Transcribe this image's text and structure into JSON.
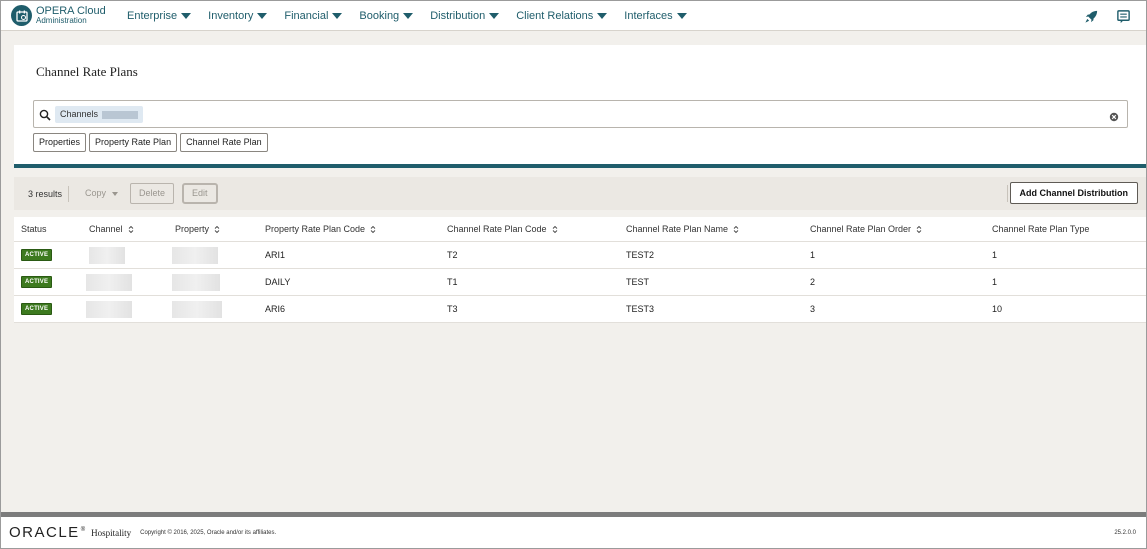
{
  "brand": {
    "title": "OPERA Cloud",
    "subtitle": "Administration"
  },
  "nav": {
    "items": [
      "Enterprise",
      "Inventory",
      "Financial",
      "Booking",
      "Distribution",
      "Client Relations",
      "Interfaces"
    ]
  },
  "page": {
    "title": "Channel Rate Plans"
  },
  "search": {
    "chip_label": "Channels"
  },
  "filters": [
    "Properties",
    "Property Rate Plan",
    "Channel Rate Plan"
  ],
  "toolbar": {
    "results": "3 results",
    "copy": "Copy",
    "delete": "Delete",
    "edit": "Edit",
    "add": "Add Channel Distribution"
  },
  "table": {
    "columns": [
      "Status",
      "Channel",
      "Property",
      "Property Rate Plan Code",
      "Channel Rate Plan Code",
      "Channel Rate Plan Name",
      "Channel Rate Plan Order",
      "Channel Rate Plan Type"
    ],
    "rows": [
      {
        "status": "ACTIVE",
        "property_rate_plan_code": "ARI1",
        "channel_rate_plan_code": "T2",
        "channel_rate_plan_name": "TEST2",
        "order": "1",
        "type": "1"
      },
      {
        "status": "ACTIVE",
        "property_rate_plan_code": "DAILY",
        "channel_rate_plan_code": "T1",
        "channel_rate_plan_name": "TEST",
        "order": "2",
        "type": "1"
      },
      {
        "status": "ACTIVE",
        "property_rate_plan_code": "ARI6",
        "channel_rate_plan_code": "T3",
        "channel_rate_plan_name": "TEST3",
        "order": "3",
        "type": "10"
      }
    ]
  },
  "footer": {
    "logo": "ORACLE",
    "logo_mark": "®",
    "hospitality": "Hospitality",
    "copyright": "Copyright © 2016, 2025, Oracle and/or its affiliates.",
    "version": "25.2.0.0"
  },
  "colors": {
    "accent": "#1f5d6b",
    "active_badge": "#3d7a1f"
  },
  "icons": [
    "opera-logo-icon",
    "caret-down-icon",
    "rocket-icon",
    "chat-icon",
    "search-icon",
    "clear-icon",
    "sort-icon"
  ]
}
